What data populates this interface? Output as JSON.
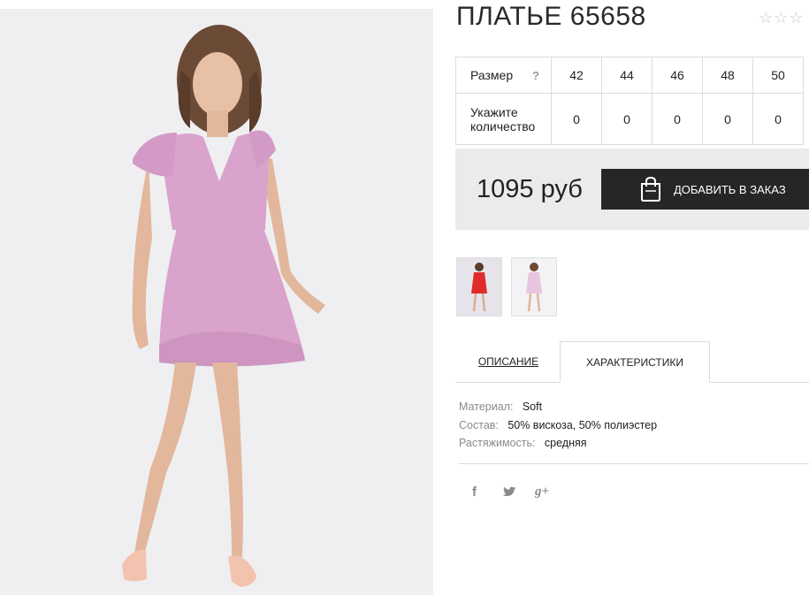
{
  "product": {
    "title": "ПЛАТЬЕ 65658",
    "rating_stars": "☆☆☆"
  },
  "sizes": {
    "size_label": "Размер",
    "help": "?",
    "values": [
      "42",
      "44",
      "46",
      "48",
      "50"
    ],
    "qty_label_line1": "Укажите",
    "qty_label_line2": "количество",
    "quantities": [
      "0",
      "0",
      "0",
      "0",
      "0"
    ]
  },
  "purchase": {
    "price": "1095 руб",
    "add_to_cart": "ДОБАВИТЬ В ЗАКАЗ",
    "bag_icon": "shopping-bag-icon"
  },
  "tabs": [
    {
      "label": "ОПИСАНИЕ"
    },
    {
      "label": "ХАРАКТЕРИСТИКИ"
    }
  ],
  "characteristics": [
    {
      "key": "Материал:",
      "value": "Soft"
    },
    {
      "key": "Состав:",
      "value": "50% вискоза, 50% полиэстер"
    },
    {
      "key": "Растяжимость:",
      "value": "средняя"
    }
  ],
  "social": {
    "facebook": "f",
    "twitter": "twitter-icon",
    "google": "g+"
  },
  "colors": {
    "dress_main": "#d9a3cc",
    "thumb_red": "#e12a2a",
    "button_bg": "#262626"
  }
}
